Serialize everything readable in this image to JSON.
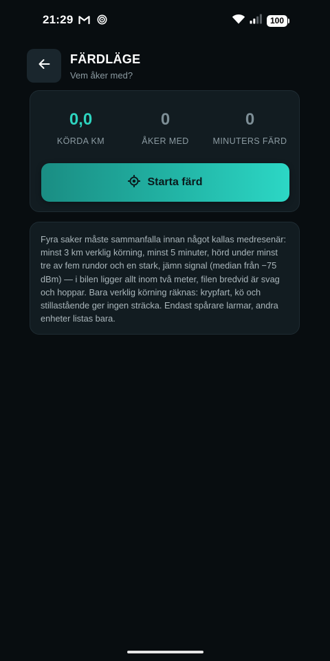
{
  "status_bar": {
    "time": "21:29",
    "battery": "100",
    "icons": [
      "gmail-icon",
      "radar-icon",
      "wifi-icon",
      "signal-icon",
      "battery-icon"
    ]
  },
  "header": {
    "title": "FÄRDLÄGE",
    "subtitle": "Vem åker med?"
  },
  "stats": [
    {
      "value": "0,0",
      "label": "KÖRDA KM"
    },
    {
      "value": "0",
      "label": "ÅKER MED"
    },
    {
      "value": "0",
      "label": "MINUTERS FÄRD"
    }
  ],
  "start_button": {
    "label": "Starta färd"
  },
  "info": {
    "text": "Fyra saker måste sammanfalla innan något kallas medresenär: minst 3 km verklig körning, minst 5 minuter, hörd under minst tre av fem rundor och en stark, jämn signal (median från −75 dBm) — i bilen ligger allt inom två meter, filen bredvid är svag och hoppar. Bara verklig körning räknas: krypfart, kö och stillastående ger ingen sträcka. Endast spårare larmar, andra enheter listas bara."
  },
  "colors": {
    "background": "#080d10",
    "card": "#121c21",
    "accent": "#2dd4bf",
    "button_start": "#1a8d83",
    "button_end": "#2cd7c5"
  }
}
